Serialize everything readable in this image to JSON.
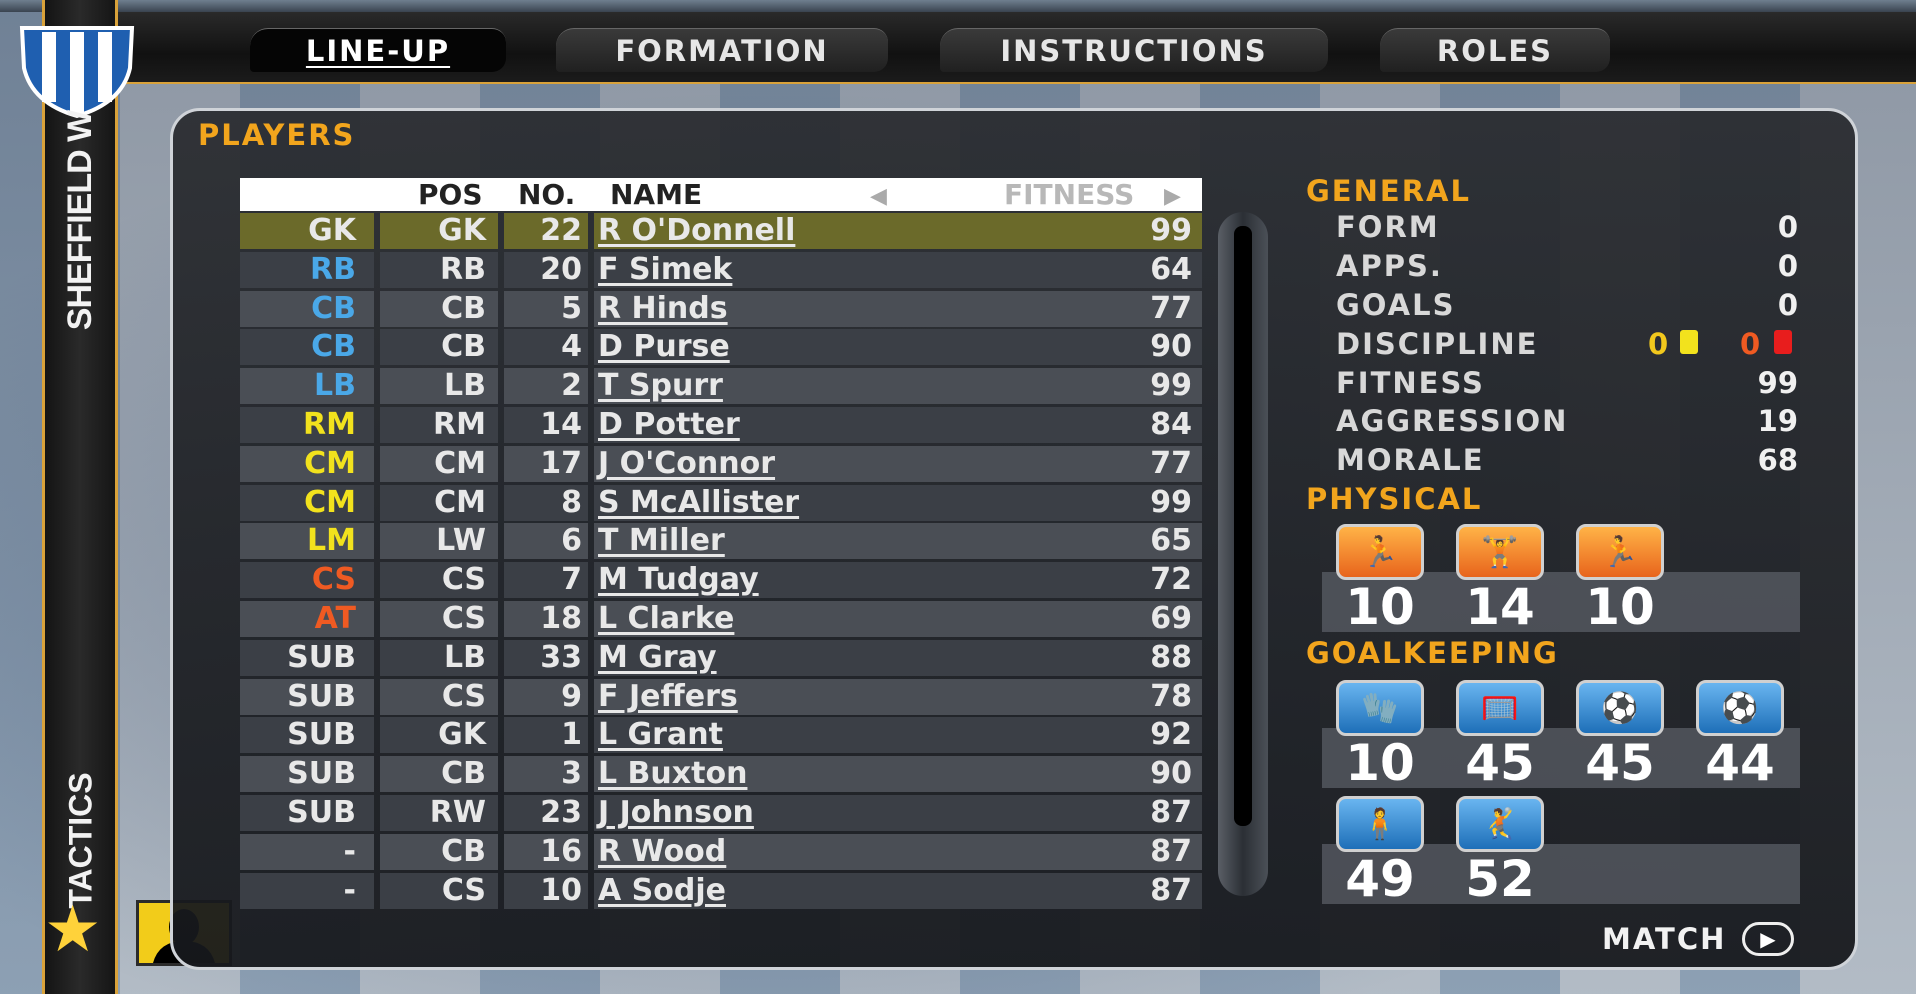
{
  "colors": {
    "accent": "#f2a51d",
    "selected_row": "#6b6a2a",
    "gk": "#e8e8e8",
    "defender": "#4aa8e8",
    "midfielder": "#f2e21d",
    "attacker": "#ef5a22",
    "sub": "#e8e8e8",
    "yellow_card": "#f2e21d",
    "red_card": "#e81d1d"
  },
  "sidebar": {
    "team_name": "SHEFFIELD W",
    "section_label": "TACTICS",
    "star_icon": "star-icon",
    "manager_icon": "manager-silhouette-icon"
  },
  "tabs": [
    {
      "label": "LINE-UP",
      "active": true
    },
    {
      "label": "FORMATION",
      "active": false
    },
    {
      "label": "INSTRUCTIONS",
      "active": false
    },
    {
      "label": "ROLES",
      "active": false
    }
  ],
  "players_panel": {
    "title": "PLAYERS",
    "headers": {
      "pos": "POS",
      "no": "NO.",
      "name": "NAME",
      "fitness": "FITNESS"
    },
    "rows": [
      {
        "role": "GK",
        "role_group": "gk",
        "pos": "GK",
        "no": "22",
        "name": "R O'Donnell",
        "fitness": "99",
        "selected": true
      },
      {
        "role": "RB",
        "role_group": "defender",
        "pos": "RB",
        "no": "20",
        "name": "F Simek",
        "fitness": "64"
      },
      {
        "role": "CB",
        "role_group": "defender",
        "pos": "CB",
        "no": "5",
        "name": "R Hinds",
        "fitness": "77"
      },
      {
        "role": "CB",
        "role_group": "defender",
        "pos": "CB",
        "no": "4",
        "name": "D Purse",
        "fitness": "90"
      },
      {
        "role": "LB",
        "role_group": "defender",
        "pos": "LB",
        "no": "2",
        "name": "T Spurr",
        "fitness": "99"
      },
      {
        "role": "RM",
        "role_group": "midfielder",
        "pos": "RM",
        "no": "14",
        "name": "D Potter",
        "fitness": "84"
      },
      {
        "role": "CM",
        "role_group": "midfielder",
        "pos": "CM",
        "no": "17",
        "name": "J O'Connor",
        "fitness": "77"
      },
      {
        "role": "CM",
        "role_group": "midfielder",
        "pos": "CM",
        "no": "8",
        "name": "S McAllister",
        "fitness": "99"
      },
      {
        "role": "LM",
        "role_group": "midfielder",
        "pos": "LW",
        "no": "6",
        "name": "T Miller",
        "fitness": "65"
      },
      {
        "role": "CS",
        "role_group": "attacker",
        "pos": "CS",
        "no": "7",
        "name": "M Tudgay",
        "fitness": "72"
      },
      {
        "role": "AT",
        "role_group": "attacker",
        "pos": "CS",
        "no": "18",
        "name": "L Clarke",
        "fitness": "69"
      },
      {
        "role": "SUB",
        "role_group": "sub",
        "pos": "LB",
        "no": "33",
        "name": "M Gray",
        "fitness": "88"
      },
      {
        "role": "SUB",
        "role_group": "sub",
        "pos": "CS",
        "no": "9",
        "name": "F Jeffers",
        "fitness": "78"
      },
      {
        "role": "SUB",
        "role_group": "sub",
        "pos": "GK",
        "no": "1",
        "name": "L Grant",
        "fitness": "92"
      },
      {
        "role": "SUB",
        "role_group": "sub",
        "pos": "CB",
        "no": "3",
        "name": "L Buxton",
        "fitness": "90"
      },
      {
        "role": "SUB",
        "role_group": "sub",
        "pos": "RW",
        "no": "23",
        "name": "J Johnson",
        "fitness": "87"
      },
      {
        "role": "-",
        "role_group": "sub",
        "pos": "CB",
        "no": "16",
        "name": "R Wood",
        "fitness": "87"
      },
      {
        "role": "-",
        "role_group": "sub",
        "pos": "CS",
        "no": "10",
        "name": "A Sodje",
        "fitness": "87"
      }
    ]
  },
  "general": {
    "title": "GENERAL",
    "form": {
      "label": "FORM",
      "value": "0"
    },
    "apps": {
      "label": "APPS.",
      "value": "0"
    },
    "goals": {
      "label": "GOALS",
      "value": "0"
    },
    "discipline": {
      "label": "DISCIPLINE",
      "yellow": "0",
      "red": "0"
    },
    "fitness": {
      "label": "FITNESS",
      "value": "99"
    },
    "aggression": {
      "label": "AGGRESSION",
      "value": "19"
    },
    "morale": {
      "label": "MORALE",
      "value": "68"
    }
  },
  "physical": {
    "title": "PHYSICAL",
    "attributes": [
      {
        "icon": "sprint-speed-icon",
        "value": "10"
      },
      {
        "icon": "strength-icon",
        "value": "14"
      },
      {
        "icon": "stamina-runner-icon",
        "value": "10"
      }
    ]
  },
  "goalkeeping": {
    "title": "GOALKEEPING",
    "attributes": [
      {
        "icon": "keeper-handling-icon",
        "value": "10"
      },
      {
        "icon": "keeper-aerial-icon",
        "value": "45"
      },
      {
        "icon": "keeper-reflex-icon",
        "value": "45"
      },
      {
        "icon": "keeper-diving-icon",
        "value": "44"
      },
      {
        "icon": "keeper-positioning-icon",
        "value": "49"
      },
      {
        "icon": "keeper-throwing-icon",
        "value": "52"
      }
    ]
  },
  "footer": {
    "match_label": "MATCH",
    "match_icon": "play-arrow-icon"
  }
}
